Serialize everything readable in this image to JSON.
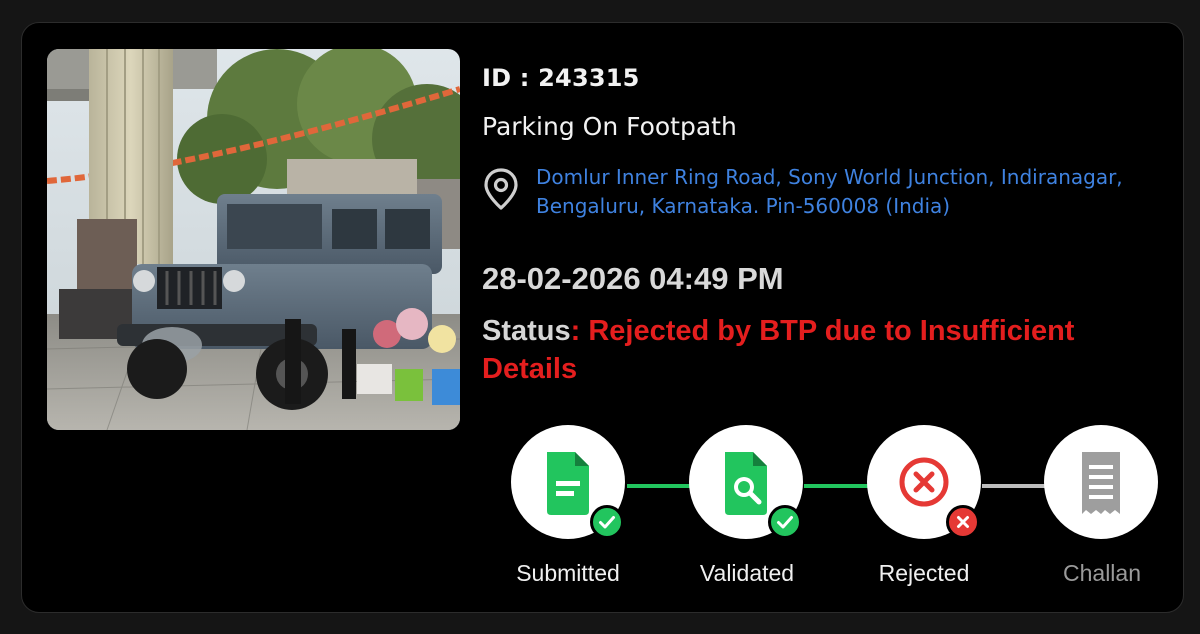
{
  "report": {
    "id_text": "ID : 243315",
    "violation": "Parking On Footpath",
    "address": "Domlur Inner Ring Road, Sony World Junction, Indiranagar, Bengaluru, Karnataka. Pin-560008 (India)",
    "datetime": "28-02-2026 04:49 PM",
    "status_label": "Status",
    "status_value": ": Rejected by BTP due to Insufficient Details"
  },
  "colors": {
    "accent_green": "#22c55e",
    "reject_red": "#e53935",
    "address_blue": "#3f82e0",
    "inactive_gray": "#9e9e9e"
  },
  "stepper": {
    "steps": [
      {
        "label": "Submitted",
        "icon": "document-icon",
        "state": "done"
      },
      {
        "label": "Validated",
        "icon": "document-search-icon",
        "state": "done"
      },
      {
        "label": "Rejected",
        "icon": "x-circle-icon",
        "state": "rejected"
      },
      {
        "label": "Challan",
        "icon": "receipt-icon",
        "state": "inactive"
      }
    ]
  }
}
